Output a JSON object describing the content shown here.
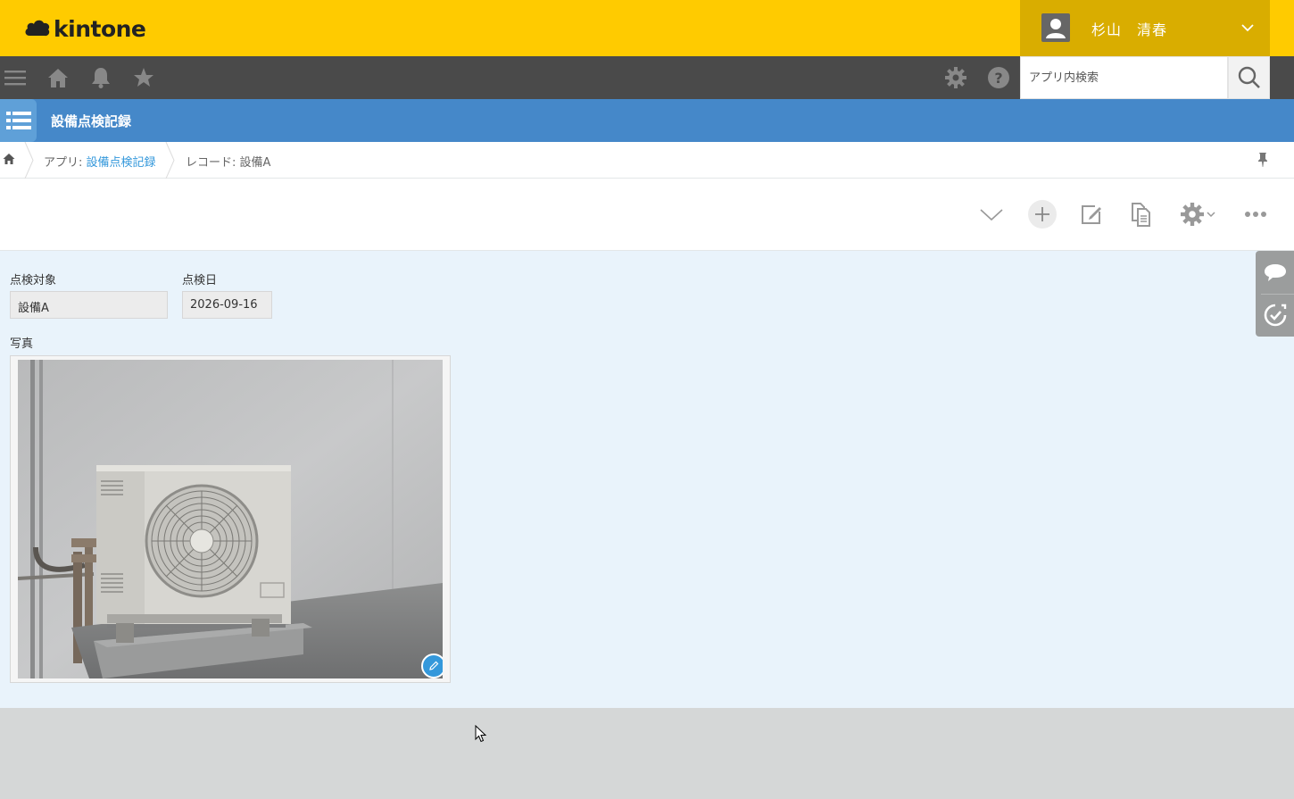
{
  "header": {
    "logo_text": "kintone",
    "user_name": "杉山　清春"
  },
  "navbar": {
    "search_placeholder": "アプリ内検索"
  },
  "app": {
    "title": "設備点検記録"
  },
  "breadcrumb": {
    "app_prefix": "アプリ: ",
    "app_name": "設備点検記録",
    "record_text": "レコード: 設備A"
  },
  "record": {
    "fields": [
      {
        "label": "点検対象",
        "value": "設備A"
      },
      {
        "label": "点検日",
        "value": "2026-09-16"
      }
    ],
    "photo_label": "写真"
  },
  "colors": {
    "header_bg": "#ffcb00",
    "user_menu_bg": "#d9ad00",
    "navbar_bg": "#4a4a4a",
    "appbar_bg": "#4588c9",
    "content_bg": "#e9f3fb",
    "link": "#3498db"
  },
  "icons": [
    "menu-icon",
    "home-icon",
    "bell-icon",
    "star-icon",
    "gear-icon",
    "help-icon",
    "search-icon",
    "app-list-icon",
    "pin-icon",
    "chevron-down-icon",
    "plus-icon",
    "edit-icon",
    "copy-icon",
    "more-icon",
    "comment-icon",
    "history-icon",
    "pencil-icon"
  ]
}
